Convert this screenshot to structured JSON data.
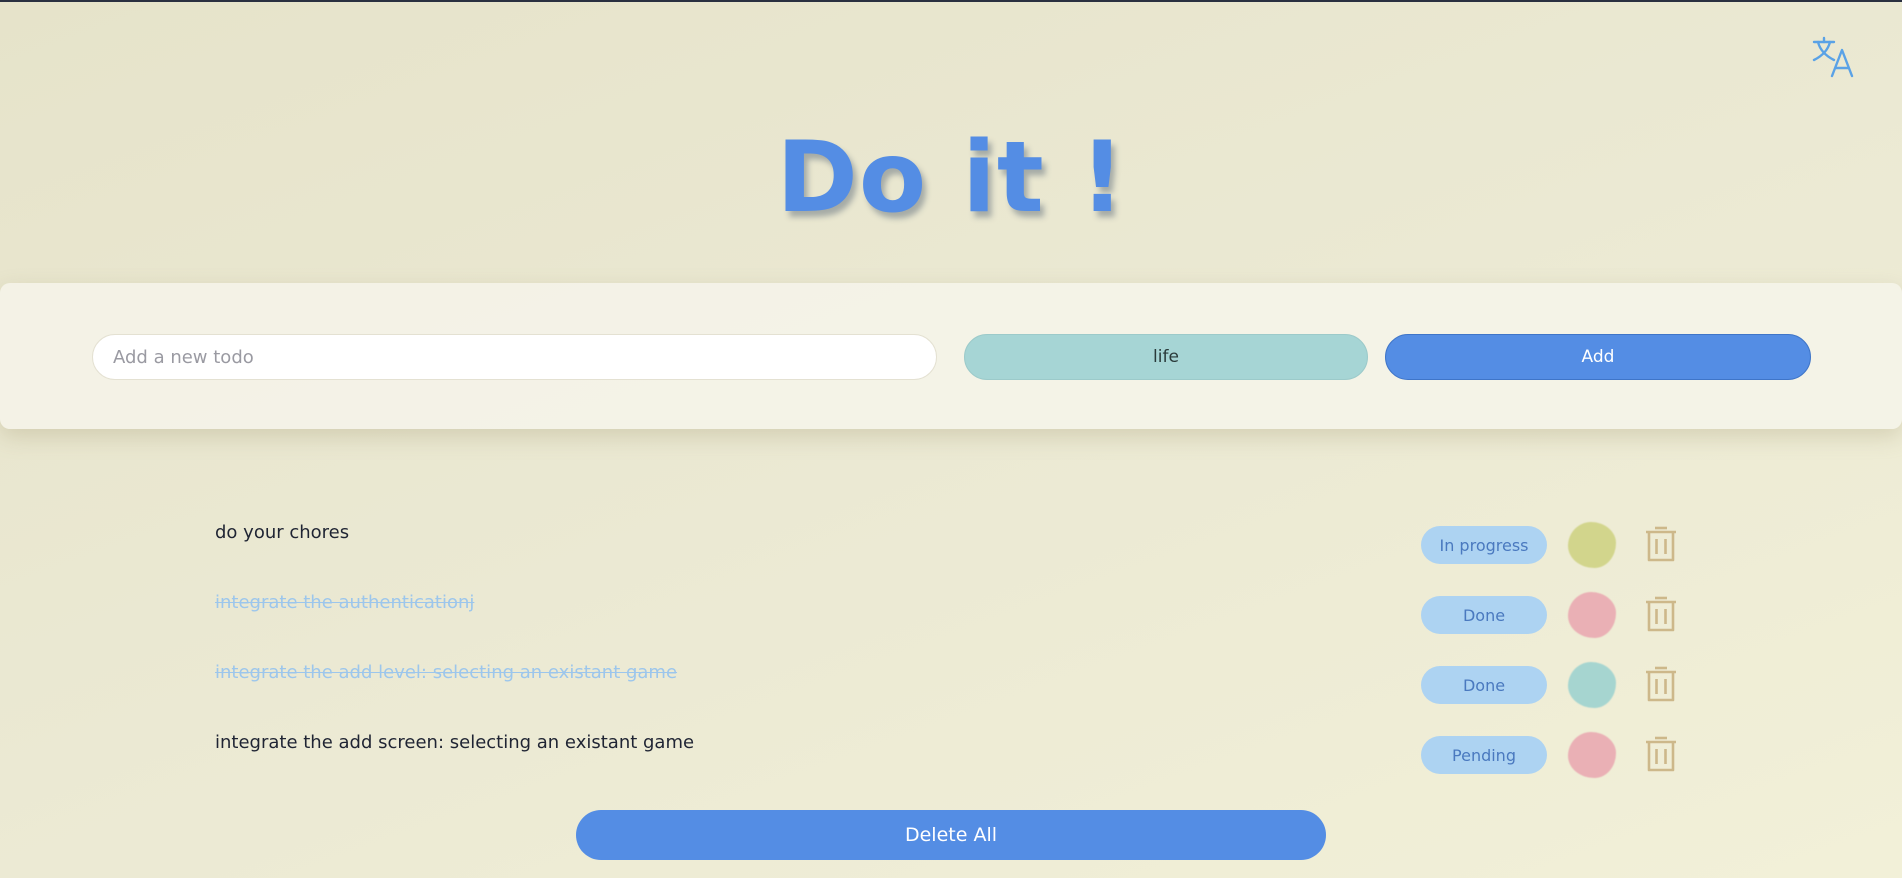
{
  "header": {
    "title": "Do it !",
    "translate_icon": "translate-icon"
  },
  "form": {
    "input_placeholder": "Add a new todo",
    "input_value": "",
    "category_selected": "life",
    "add_label": "Add"
  },
  "todos": [
    {
      "text": "do your chores",
      "completed": false,
      "status": "In progress",
      "color": "#d2d58c"
    },
    {
      "text": "integrate the authenticationj",
      "completed": true,
      "status": "Done",
      "color": "#eab0b5"
    },
    {
      "text": "integrate the add level: selecting an existant game",
      "completed": true,
      "status": "Done",
      "color": "#a6d5d0"
    },
    {
      "text": "integrate the add screen: selecting an existant game",
      "completed": false,
      "status": "Pending",
      "color": "#eab0b5"
    }
  ],
  "footer": {
    "delete_all_label": "Delete All"
  },
  "colors": {
    "accent": "#548de4",
    "category_bg": "#a6d5d5",
    "status_bg": "#add3f2",
    "trash": "#cdb88a",
    "done_text": "#9cc6ec"
  }
}
